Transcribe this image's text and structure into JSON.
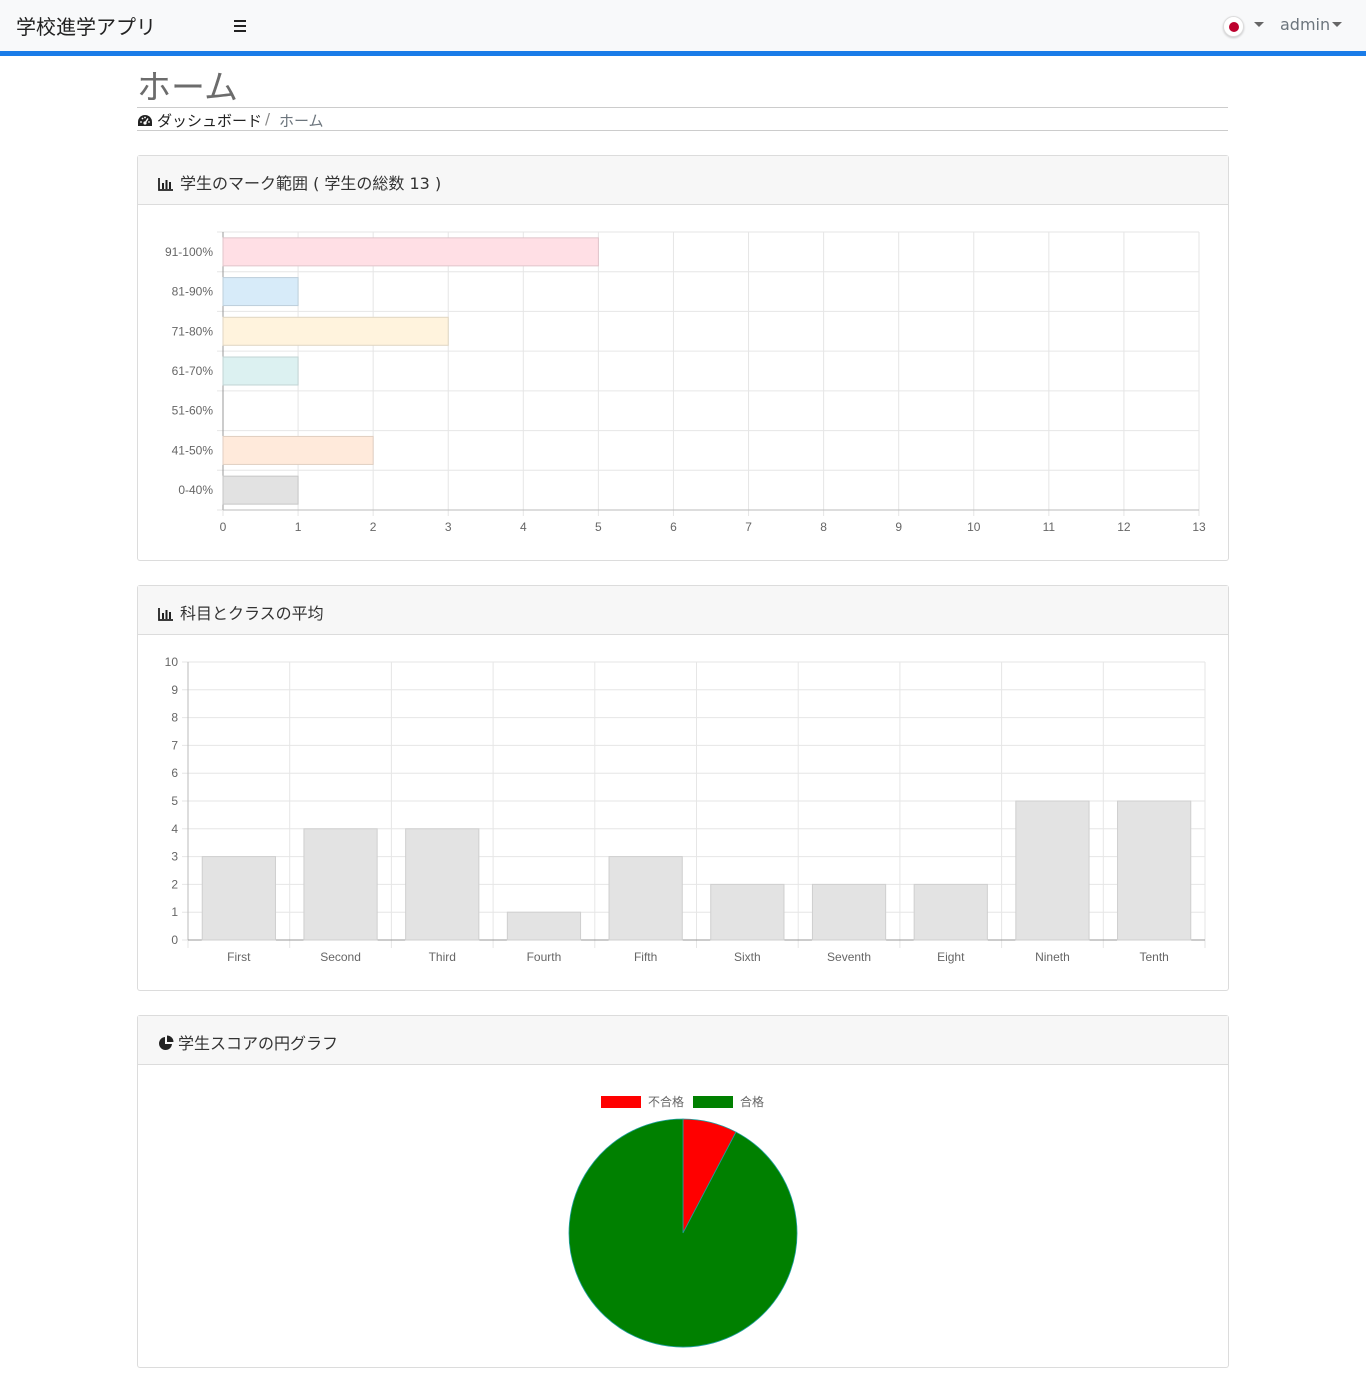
{
  "navbar": {
    "brand": "学校進学アプリ",
    "menu_icon": "hamburger-icon",
    "language_flag": "japan-flag-icon",
    "user": "admin"
  },
  "page": {
    "title": "ホーム",
    "breadcrumb": {
      "home": "ダッシュボード",
      "separator": "/",
      "current": "ホーム"
    }
  },
  "cards": {
    "marks": {
      "title": "学生のマーク範囲 ( 学生の総数 13 )",
      "icon": "bar-chart-icon"
    },
    "averages": {
      "title": "科目とクラスの平均",
      "icon": "bar-chart-icon"
    },
    "pie": {
      "title": "学生スコアの円グラフ",
      "icon": "pie-chart-icon"
    }
  },
  "chart_data": [
    {
      "type": "bar",
      "orientation": "horizontal",
      "categories": [
        "91-100%",
        "81-90%",
        "71-80%",
        "61-70%",
        "51-60%",
        "41-50%",
        "0-40%"
      ],
      "values": [
        5,
        1,
        3,
        1,
        0,
        2,
        1
      ],
      "colors": [
        "#ffdfe5",
        "#d7ebf9",
        "#fff3dd",
        "#dcf1f1",
        "#ece6fb",
        "#ffeadb",
        "#e2e2e2"
      ],
      "xlim": [
        0,
        13
      ],
      "xticks": [
        "0",
        "1",
        "2",
        "3",
        "4",
        "5",
        "6",
        "7",
        "8",
        "9",
        "10",
        "11",
        "12",
        "13"
      ],
      "grid": true
    },
    {
      "type": "bar",
      "categories": [
        "First",
        "Second",
        "Third",
        "Fourth",
        "Fifth",
        "Sixth",
        "Seventh",
        "Eight",
        "Nineth",
        "Tenth"
      ],
      "values": [
        3,
        4,
        4,
        1,
        3,
        2,
        2,
        2,
        5,
        5
      ],
      "color": "#e3e3e3",
      "ylim": [
        0,
        10
      ],
      "yticks": [
        "0",
        "1",
        "2",
        "3",
        "4",
        "5",
        "6",
        "7",
        "8",
        "9",
        "10"
      ],
      "grid": true
    },
    {
      "type": "pie",
      "labels": [
        "不合格",
        "合格"
      ],
      "values": [
        1,
        12
      ],
      "colors": [
        "#ff0000",
        "#008000"
      ],
      "legend": "top"
    }
  ]
}
